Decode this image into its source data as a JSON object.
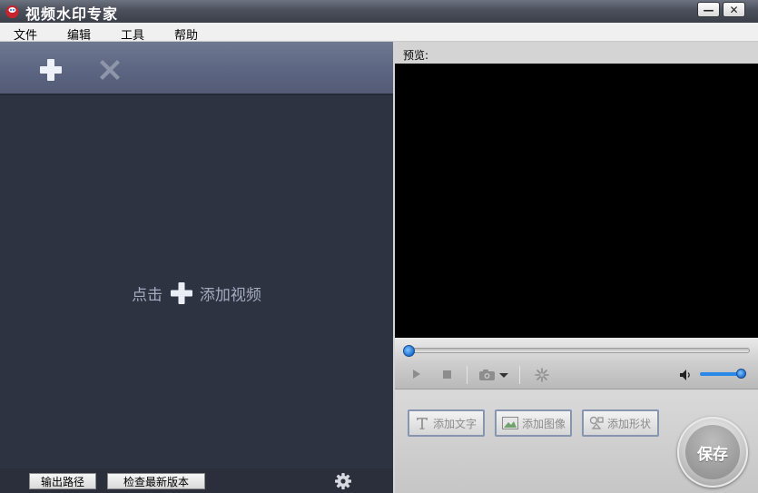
{
  "window": {
    "title": "视频水印专家",
    "minimize_label": "—",
    "close_label": "✕"
  },
  "menu": {
    "items": [
      "文件",
      "编辑",
      "工具",
      "帮助"
    ]
  },
  "left_panel": {
    "toolbar": {
      "add_icon": "plus-icon",
      "delete_icon": "x-icon"
    },
    "hint_prefix": "点击",
    "hint_suffix": "添加视频",
    "output_path_button": "输出路径",
    "check_update_button": "检查最新版本",
    "settings_icon": "gear-icon"
  },
  "right_panel": {
    "preview_label": "预览:",
    "seek_progress": 0,
    "volume_level": 1.0,
    "add_text_button": "添加文字",
    "add_image_button": "添加图像",
    "add_shape_button": "添加形状",
    "save_button": "保存"
  },
  "colors": {
    "left_bg": "#2e3442",
    "toolbar_bg": "#5b6480",
    "accent_blue": "#2b8ae6",
    "video_bg": "#000000"
  }
}
